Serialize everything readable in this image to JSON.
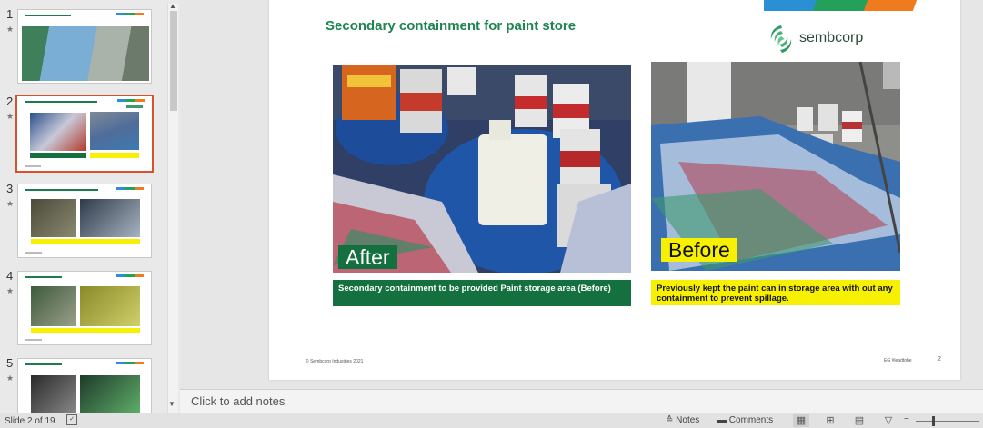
{
  "thumbnails": [
    {
      "number": "1"
    },
    {
      "number": "2"
    },
    {
      "number": "3"
    },
    {
      "number": "4"
    },
    {
      "number": "5"
    }
  ],
  "slide": {
    "title": "Secondary containment for paint store",
    "logo_text": "sembcorp",
    "after_label": "After",
    "before_label": "Before",
    "after_caption": "Secondary containment to be provided Paint storage area (Before)",
    "before_caption": "Previously kept the paint can in storage area with out any containment to prevent spillage.",
    "footer_left": "© Sembcorp Industries 2021",
    "footer_right": "EG #leadtobe",
    "page_number": "2",
    "colors": {
      "title": "#1e8450",
      "after_tag": "#14703f",
      "before_tag": "#f7f000",
      "brand_blue": "#2a8fd3",
      "brand_green": "#25a05a",
      "brand_orange": "#f07a1e"
    }
  },
  "notes": {
    "placeholder": "Click to add notes"
  },
  "status": {
    "slide_indicator": "Slide 2 of 19",
    "notes_label": "Notes",
    "comments_label": "Comments"
  },
  "icons": [
    "notes-icon",
    "comments-icon",
    "normal-view-icon",
    "slide-sorter-icon",
    "reading-view-icon",
    "slideshow-icon",
    "spellcheck-icon"
  ]
}
